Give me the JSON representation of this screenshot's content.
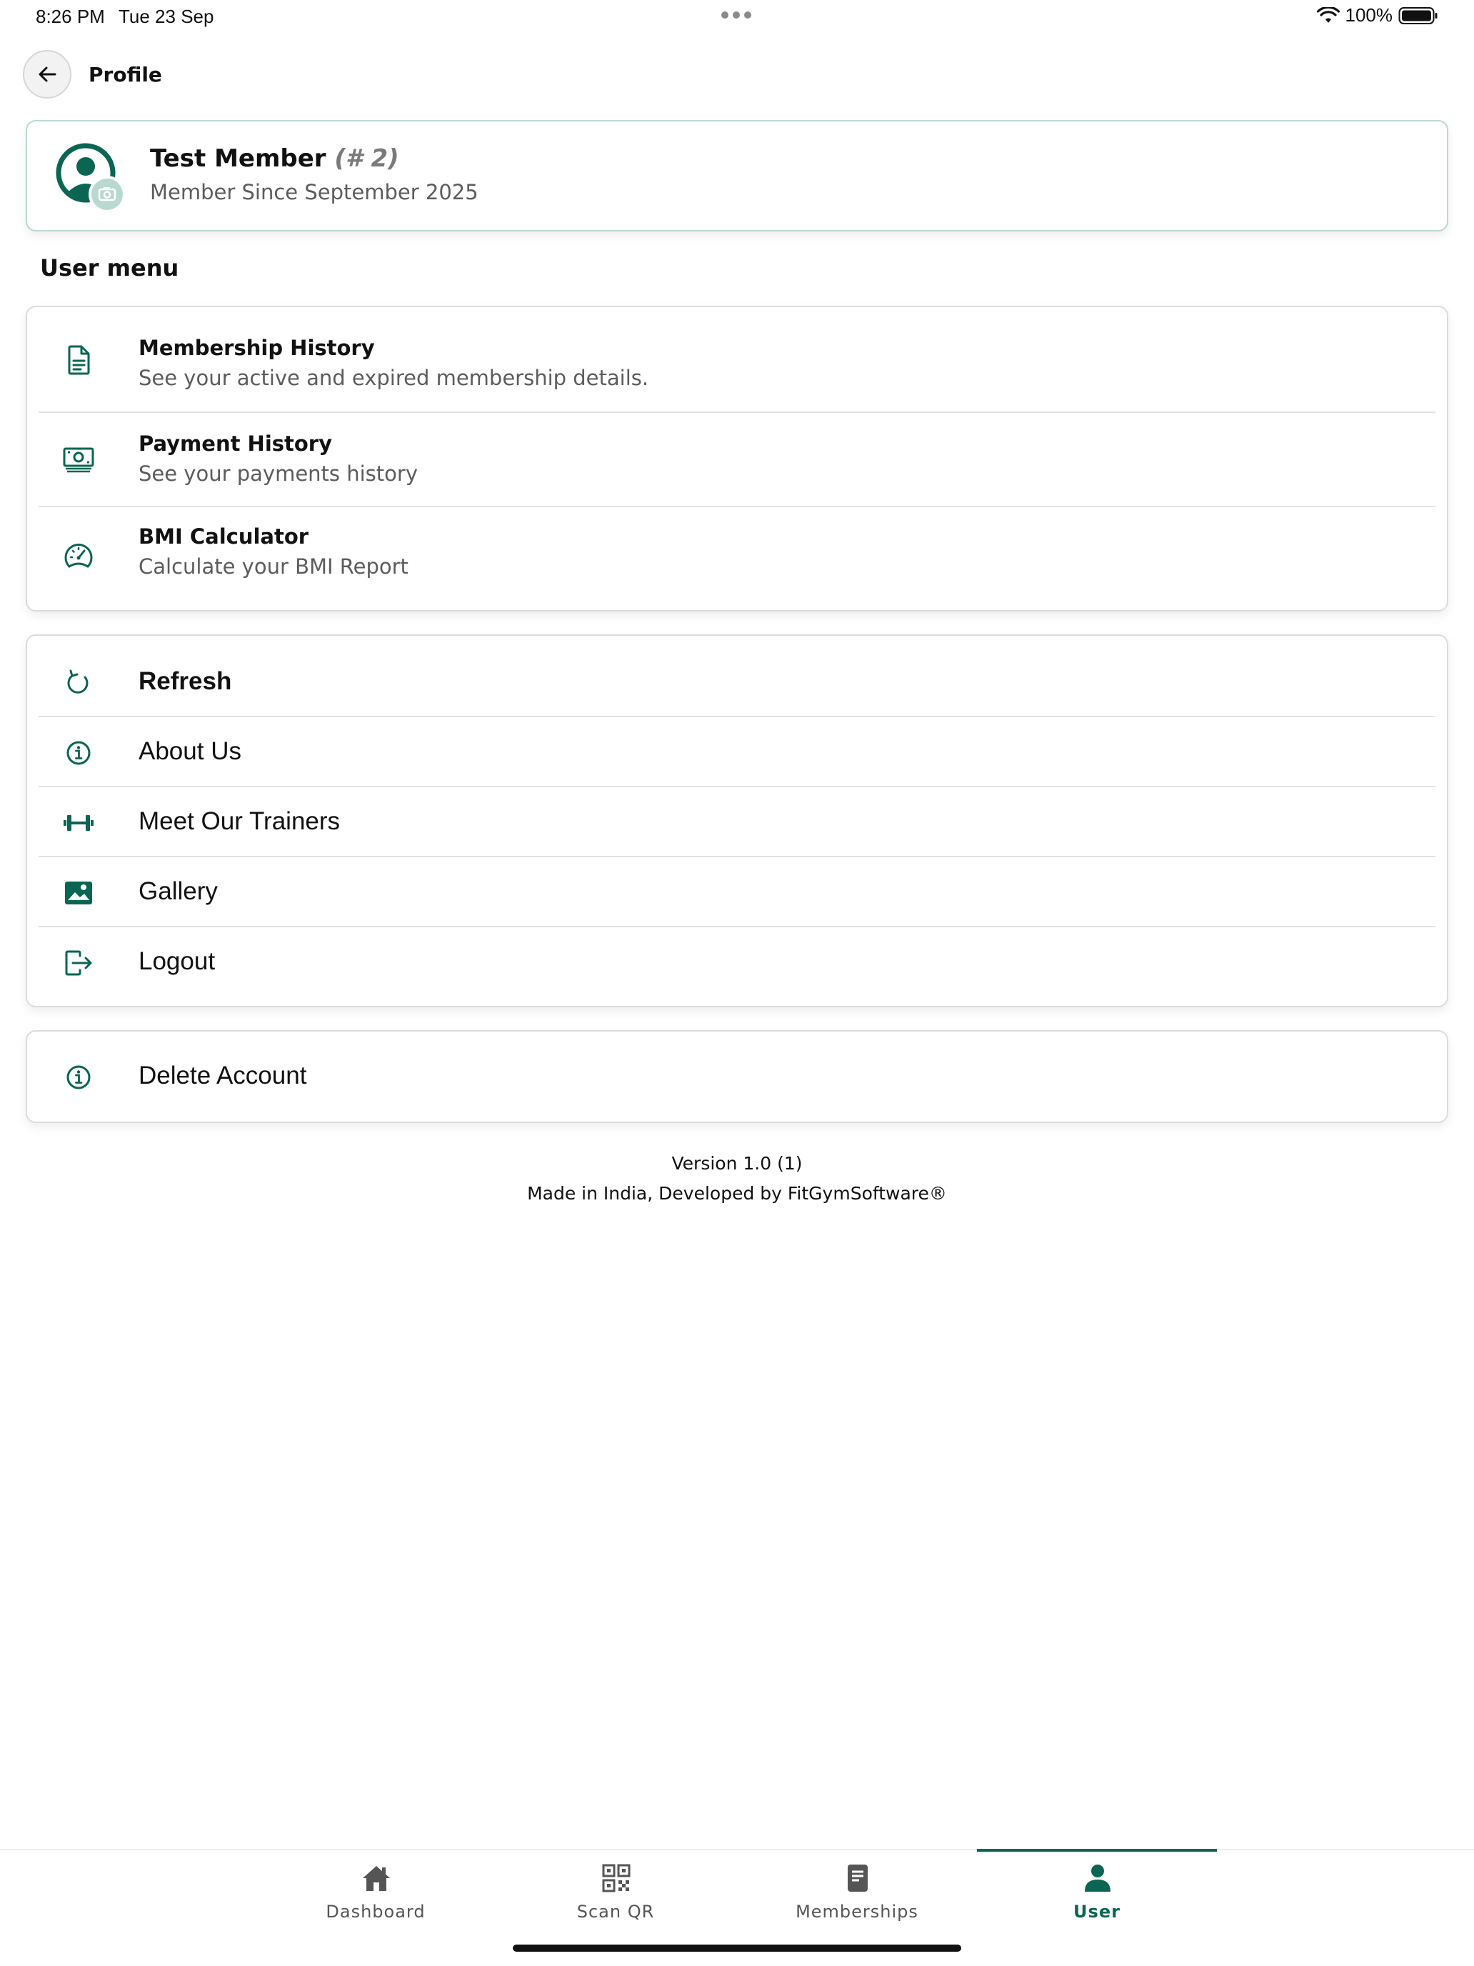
{
  "status_bar": {
    "time": "8:26 PM",
    "date": "Tue 23 Sep",
    "battery": "100%"
  },
  "header": {
    "title": "Profile"
  },
  "profile": {
    "name": "Test Member",
    "id": "(# 2)",
    "since": "Member Since September 2025"
  },
  "user_menu": {
    "title": "User menu",
    "items": [
      {
        "title": "Membership History",
        "subtitle": "See your active and expired membership details.",
        "icon": "document-icon"
      },
      {
        "title": "Payment History",
        "subtitle": "See your payments history",
        "icon": "cash-icon"
      },
      {
        "title": "BMI Calculator",
        "subtitle": "Calculate your BMI Report",
        "icon": "speedometer-icon"
      }
    ]
  },
  "actions": {
    "items": [
      {
        "label": "Refresh",
        "icon": "refresh-icon"
      },
      {
        "label": "About Us",
        "icon": "info-icon"
      },
      {
        "label": "Meet Our Trainers",
        "icon": "dumbbell-icon"
      },
      {
        "label": "Gallery",
        "icon": "image-icon"
      },
      {
        "label": "Logout",
        "icon": "logout-icon"
      }
    ]
  },
  "danger": {
    "label": "Delete Account",
    "icon": "info-icon"
  },
  "footer": {
    "version": "Version 1.0 (1)",
    "made_in": "Made in India, Developed by FitGymSoftware®"
  },
  "bottom_nav": {
    "tabs": [
      {
        "label": "Dashboard",
        "icon": "home-icon"
      },
      {
        "label": "Scan QR",
        "icon": "qr-code-icon"
      },
      {
        "label": "Memberships",
        "icon": "book-icon"
      },
      {
        "label": "User",
        "icon": "user-icon"
      }
    ],
    "active": "User"
  },
  "colors": {
    "accent": "#0a6552",
    "accent_light": "#b9d9d0",
    "text": "#111111",
    "muted": "#5c5c5c"
  }
}
